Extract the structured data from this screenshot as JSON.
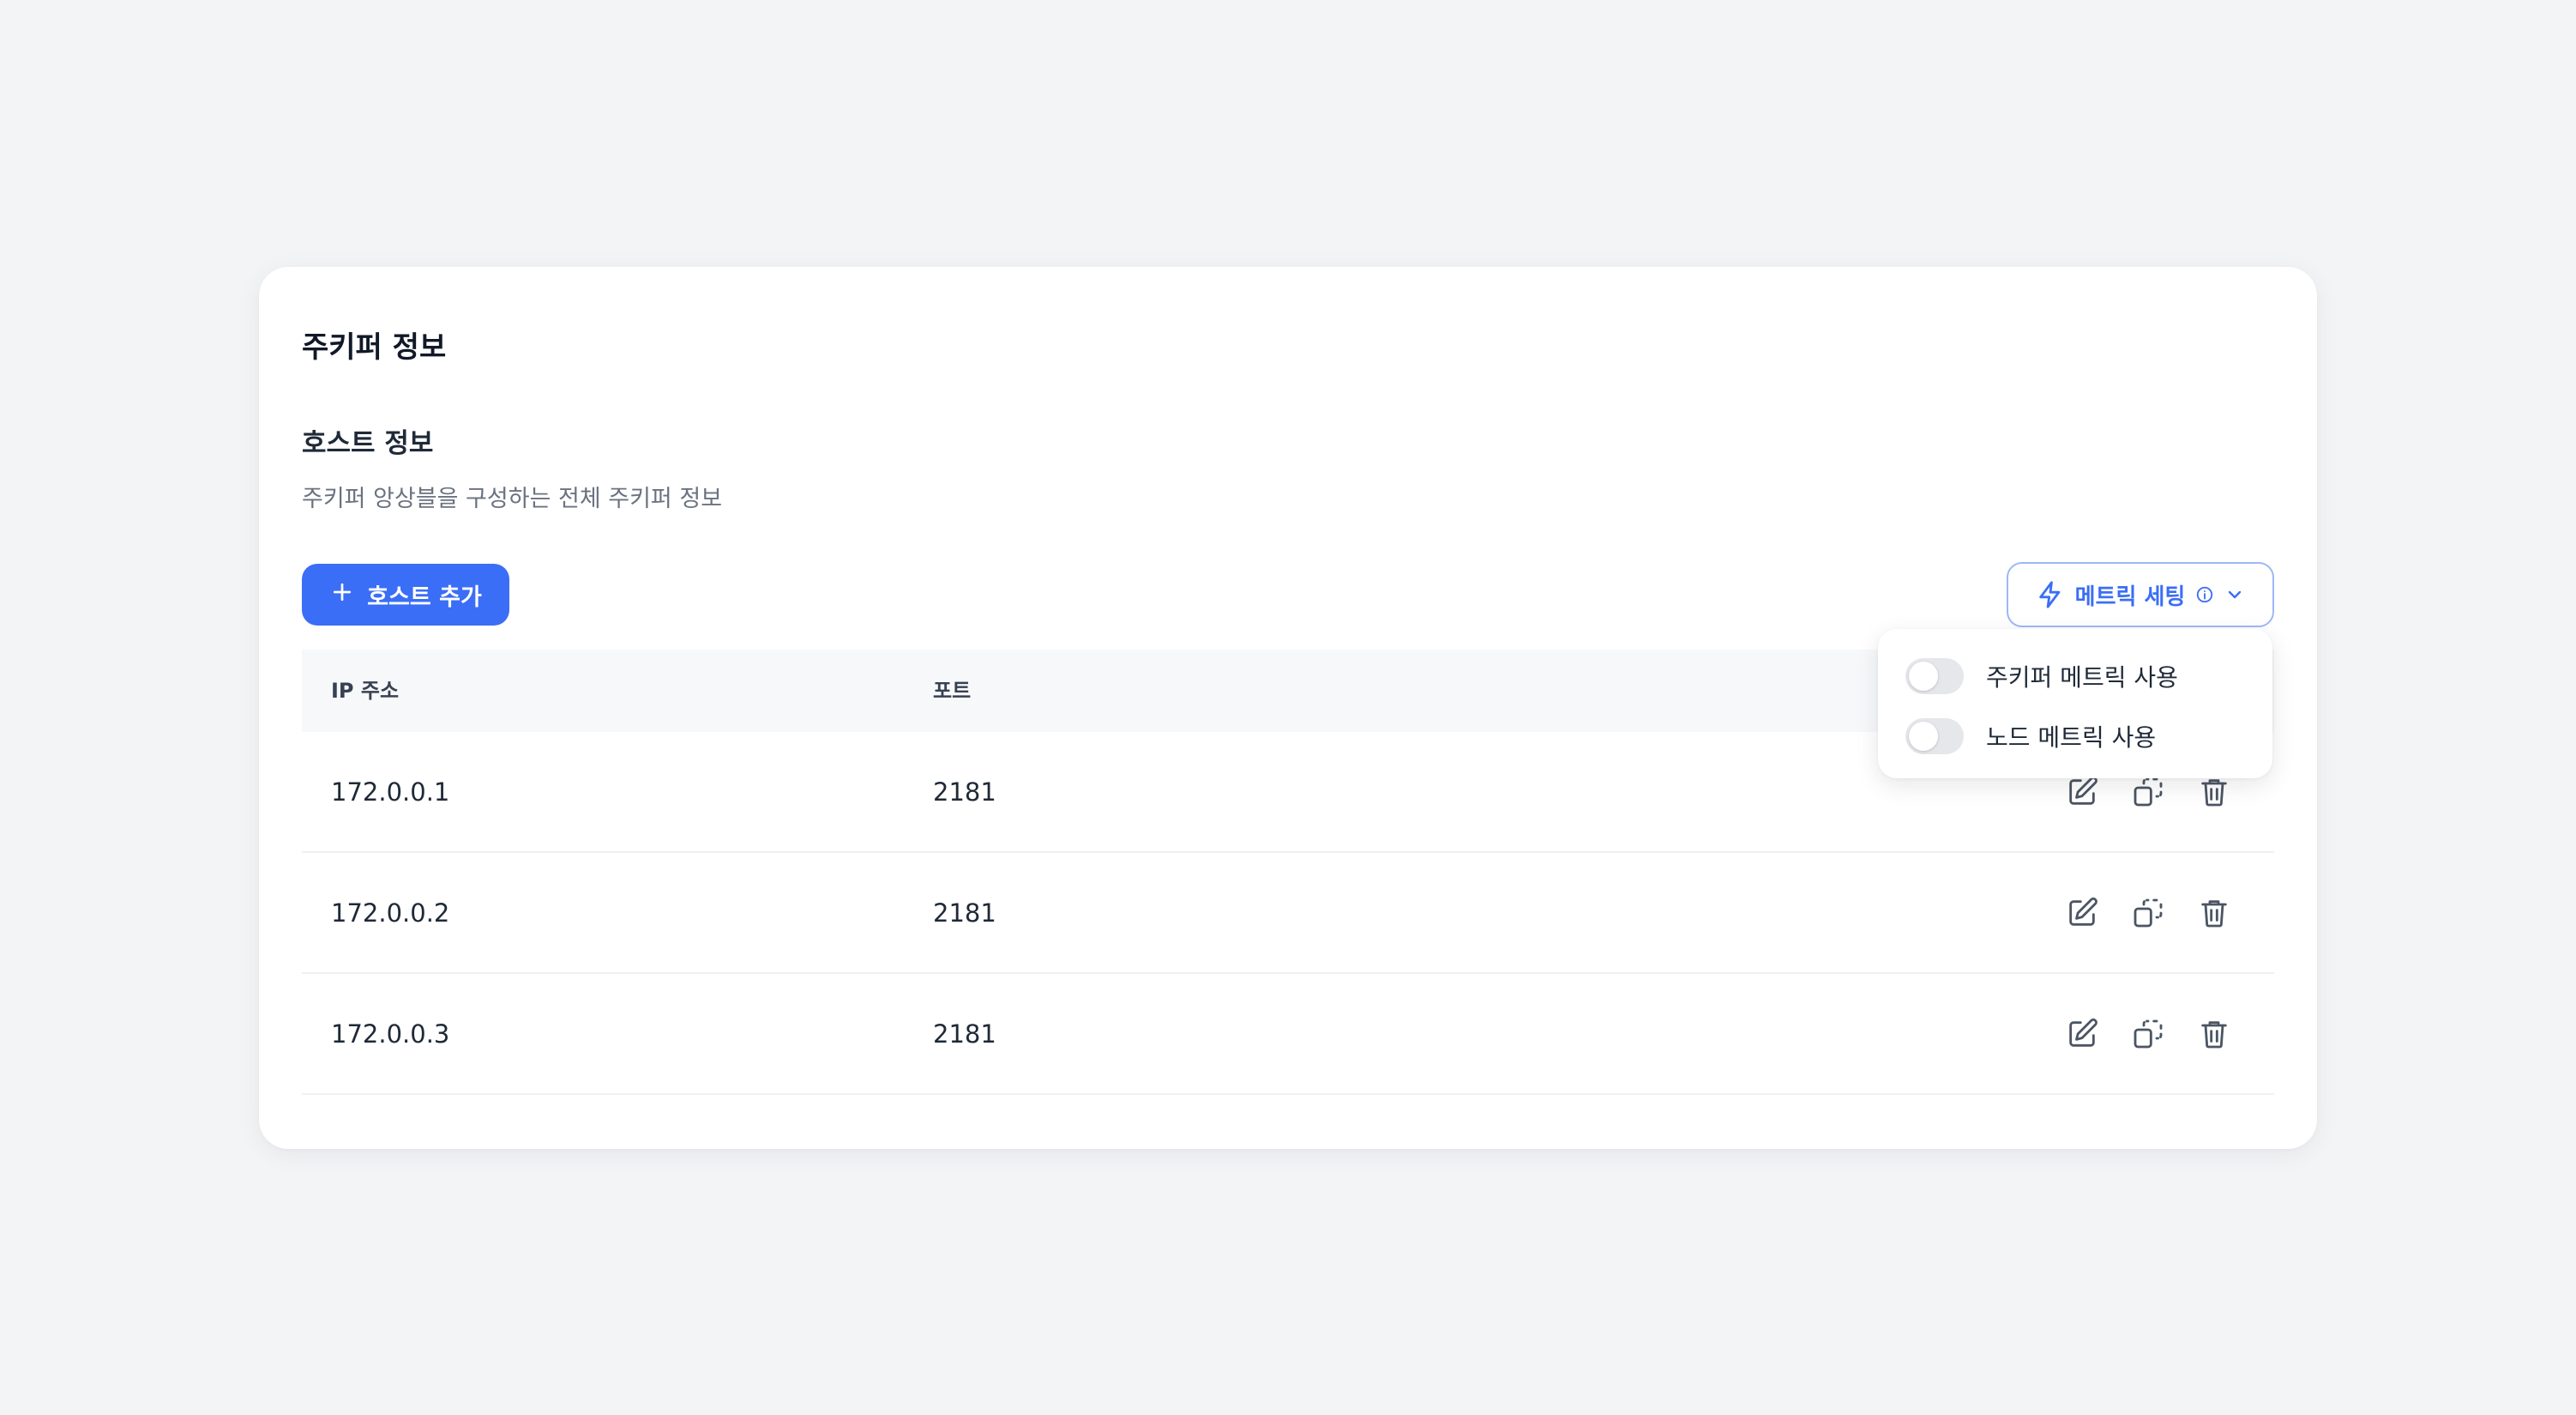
{
  "card": {
    "title": "주키퍼 정보"
  },
  "section": {
    "title": "호스트 정보",
    "description": "주키퍼 앙상블을 구성하는 전체 주키퍼 정보"
  },
  "toolbar": {
    "add_host_label": "호스트 추가",
    "metric_settings_label": "메트릭 세팅"
  },
  "table": {
    "headers": {
      "ip": "IP 주소",
      "port": "포트"
    },
    "rows": [
      {
        "ip": "172.0.0.1",
        "port": "2181"
      },
      {
        "ip": "172.0.0.2",
        "port": "2181"
      },
      {
        "ip": "172.0.0.3",
        "port": "2181"
      }
    ]
  },
  "metric_menu": {
    "items": [
      {
        "label": "주키퍼 메트릭 사용",
        "enabled": false
      },
      {
        "label": "노드 메트릭 사용",
        "enabled": false
      }
    ]
  },
  "icons": {
    "add": "plus-icon",
    "metric": "bolt-icon",
    "info": "info-icon",
    "dropdown": "chevron-down-icon",
    "edit": "edit-icon",
    "duplicate": "duplicate-icon",
    "delete": "trash-icon"
  },
  "colors": {
    "accent": "#3b6ef6",
    "background": "#f3f4f6",
    "card": "#ffffff",
    "toggle_off": "#e5e7eb"
  }
}
